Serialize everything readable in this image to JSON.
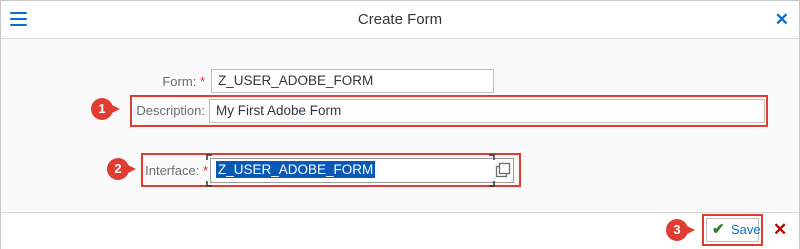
{
  "header": {
    "title": "Create Form"
  },
  "form": {
    "form_label": "Form:",
    "form_value": "Z_USER_ADOBE_FORM",
    "description_label": "Description:",
    "description_value": "My First Adobe Form",
    "interface_label": "Interface:",
    "interface_value": "Z_USER_ADOBE_FORM",
    "required_marker": "*"
  },
  "callouts": [
    "1",
    "2",
    "3"
  ],
  "footer": {
    "save_label": "Save"
  },
  "colors": {
    "accent": "#0a6ed1",
    "callout": "#e03c31",
    "save_check": "#2b7d2b",
    "cancel": "#bb0000"
  },
  "icons": [
    "menu-icon",
    "close-icon",
    "value-help-icon",
    "checkmark-icon",
    "cancel-icon"
  ]
}
